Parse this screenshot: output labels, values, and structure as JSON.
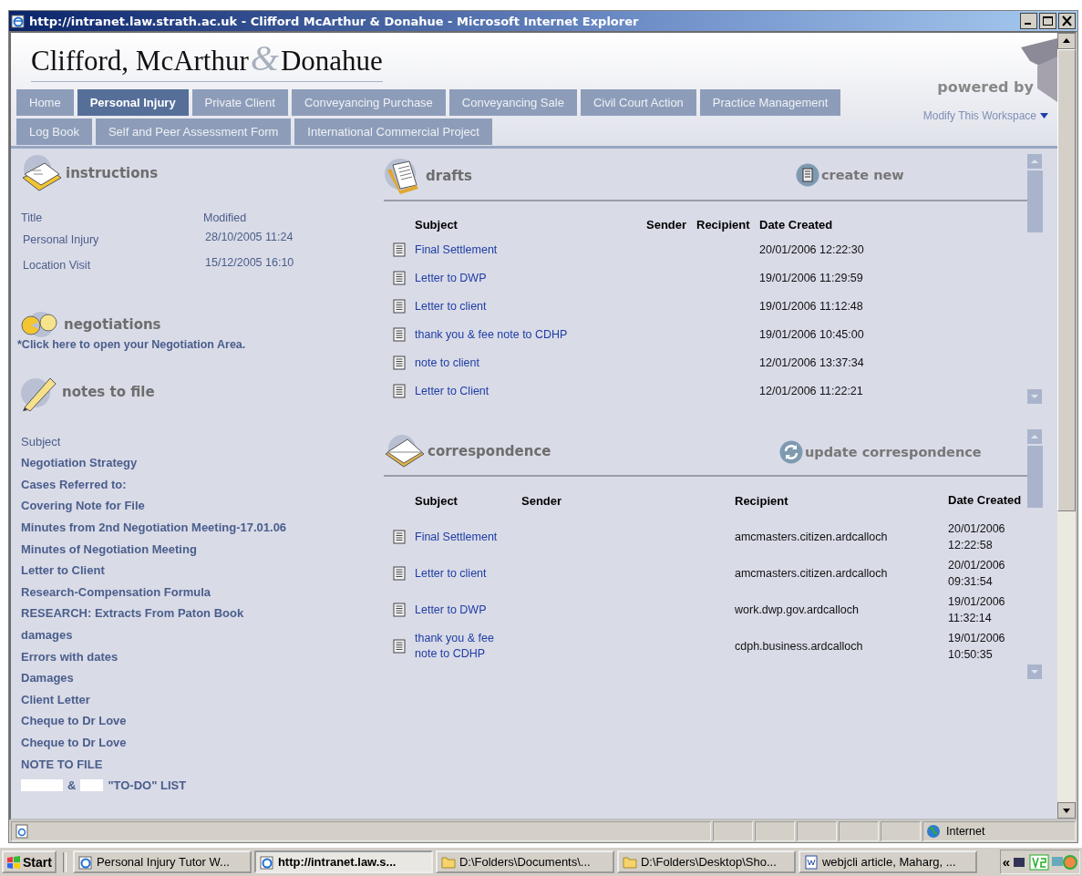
{
  "window": {
    "title": "http://intranet.law.strath.ac.uk - Clifford McArthur & Donahue - Microsoft Internet Explorer"
  },
  "header": {
    "logo_left": "Clifford, McArthur",
    "logo_amp": "&",
    "logo_right": "Donahue",
    "powered_by": "powered by",
    "modify_link": "Modify This Workspace"
  },
  "tab_rows": [
    [
      {
        "label": "Home",
        "selected": false
      },
      {
        "label": "Personal Injury",
        "selected": true
      },
      {
        "label": "Private Client",
        "selected": false
      },
      {
        "label": "Conveyancing Purchase",
        "selected": false
      },
      {
        "label": "Conveyancing Sale",
        "selected": false
      },
      {
        "label": "Civil Court Action",
        "selected": false
      },
      {
        "label": "Practice Management",
        "selected": false
      }
    ],
    [
      {
        "label": "Log Book",
        "selected": false
      },
      {
        "label": "Self and Peer Assessment Form",
        "selected": false
      },
      {
        "label": "International Commercial Project",
        "selected": false
      }
    ]
  ],
  "instructions": {
    "heading": "instructions",
    "columns": [
      "Title",
      "Modified"
    ],
    "rows": [
      {
        "title": "Personal Injury",
        "modified": "28/10/2005 11:24"
      },
      {
        "title": "Location Visit",
        "modified": "15/12/2005 16:10"
      }
    ]
  },
  "negotiations": {
    "heading": "negotiations",
    "link": "*Click here to open your Negotiation Area."
  },
  "notes": {
    "heading": "notes to file",
    "column": "Subject",
    "items": [
      {
        "parts": [
          {
            "kind": "text",
            "text": "Negotiation Strategy"
          }
        ]
      },
      {
        "parts": [
          {
            "kind": "text",
            "text": "Cases Referred to:"
          }
        ]
      },
      {
        "parts": [
          {
            "kind": "text",
            "text": "Covering Note for File"
          }
        ]
      },
      {
        "parts": [
          {
            "kind": "text",
            "text": "Minutes from 2nd Negotiation Meeting-17.01.06"
          }
        ]
      },
      {
        "parts": [
          {
            "kind": "text",
            "text": "Minutes of Negotiation Meeting"
          }
        ]
      },
      {
        "parts": [
          {
            "kind": "text",
            "text": "Letter to Client"
          }
        ]
      },
      {
        "parts": [
          {
            "kind": "text",
            "text": "Research-Compensation Formula"
          }
        ]
      },
      {
        "parts": [
          {
            "kind": "text",
            "text": "RESEARCH: Extracts From Paton Book"
          }
        ]
      },
      {
        "parts": [
          {
            "kind": "text",
            "text": "damages"
          }
        ]
      },
      {
        "parts": [
          {
            "kind": "text",
            "text": "Errors with dates"
          }
        ]
      },
      {
        "parts": [
          {
            "kind": "text",
            "text": "Damages"
          }
        ]
      },
      {
        "parts": [
          {
            "kind": "text",
            "text": "Client Letter"
          }
        ]
      },
      {
        "parts": [
          {
            "kind": "text",
            "text": "Cheque to Dr Love"
          }
        ]
      },
      {
        "parts": [
          {
            "kind": "text",
            "text": "Cheque to Dr Love"
          }
        ]
      },
      {
        "parts": [
          {
            "kind": "text",
            "text": "NOTE TO FILE"
          }
        ]
      },
      {
        "parts": [
          {
            "kind": "redacted"
          },
          {
            "kind": "text",
            "text": "&"
          },
          {
            "kind": "redacted"
          },
          {
            "kind": "text",
            "text": "\"TO-DO\" LIST"
          }
        ]
      }
    ]
  },
  "drafts": {
    "heading": "drafts",
    "action": "create new",
    "columns": [
      "Subject",
      "Sender",
      "Recipient",
      "Date Created"
    ],
    "rows": [
      {
        "subject": "Final Settlement",
        "date": "20/01/2006 12:22:30"
      },
      {
        "subject": "Letter to DWP",
        "date": "19/01/2006 11:29:59"
      },
      {
        "subject": "Letter to client",
        "date": "19/01/2006 11:12:48"
      },
      {
        "subject": "thank you & fee note to CDHP",
        "date": "19/01/2006 10:45:00"
      },
      {
        "subject": "note to client",
        "date": "12/01/2006 13:37:34"
      },
      {
        "subject": "Letter to Client",
        "date": "12/01/2006 11:22:21"
      }
    ]
  },
  "correspondence": {
    "heading": "correspondence",
    "action": "update correspondence",
    "columns": [
      "Subject",
      "Sender",
      "Recipient",
      "Date Created"
    ],
    "rows": [
      {
        "subject": "Final Settlement",
        "recipient": "amcmasters.citizen.ardcalloch",
        "date": "20/01/2006 12:22:58"
      },
      {
        "subject": "Letter to client",
        "recipient": "amcmasters.citizen.ardcalloch",
        "date": "20/01/2006 09:31:54"
      },
      {
        "subject": "Letter to DWP",
        "recipient": "work.dwp.gov.ardcalloch",
        "date": "19/01/2006 11:32:14"
      },
      {
        "subject": "thank you & fee note to CDHP",
        "recipient": "cdph.business.ardcalloch",
        "date": "19/01/2006 10:50:35"
      }
    ]
  },
  "status_bar": {
    "zone": "Internet"
  },
  "taskbar": {
    "start": "Start",
    "items": [
      {
        "kind": "ie",
        "label": "Personal Injury Tutor W...",
        "selected": false
      },
      {
        "kind": "ie",
        "label": "http://intranet.law.s...",
        "selected": true
      },
      {
        "kind": "folder",
        "label": "D:\\Folders\\Documents\\...",
        "selected": false
      },
      {
        "kind": "folder",
        "label": "D:\\Folders\\Desktop\\Sho...",
        "selected": false
      },
      {
        "kind": "word",
        "label": "webjcli article, Maharg, ...",
        "selected": false
      }
    ],
    "tray_chevron": "«"
  }
}
